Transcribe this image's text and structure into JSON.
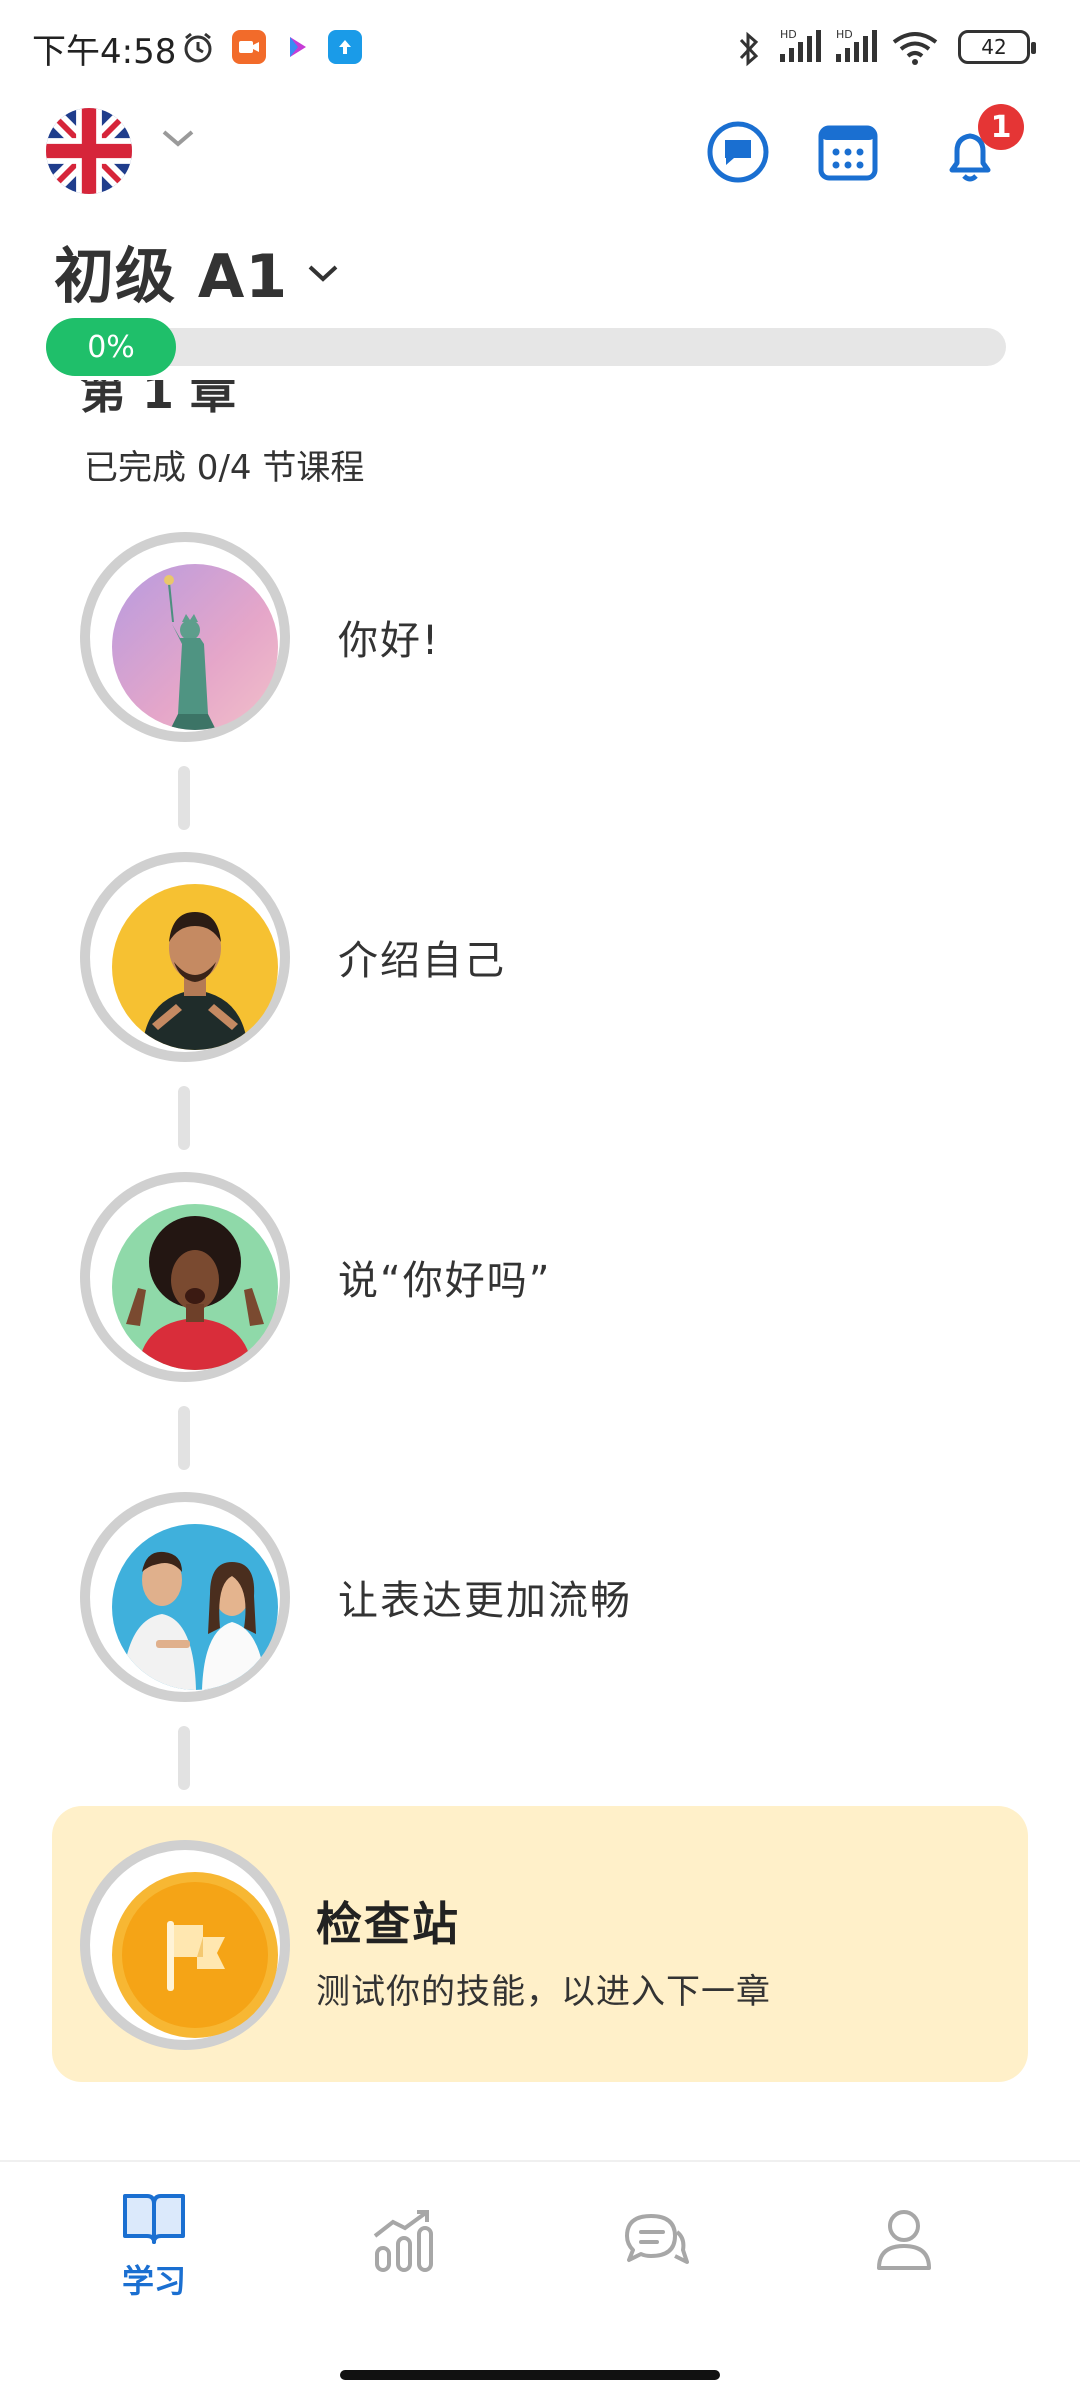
{
  "status_bar": {
    "time": "下午4:58",
    "battery": "42",
    "network_label_1": "HD",
    "network_label_2": "HD"
  },
  "header": {
    "language_flag": "uk-flag-icon",
    "notification_count": "1",
    "level_title": "初级 A1",
    "progress_text": "0%",
    "progress_value": 0
  },
  "chapter": {
    "partial_title": "第 1 章",
    "progress_text": "已完成 0/4 节课程"
  },
  "lessons": [
    {
      "label": "你好!"
    },
    {
      "label": "介绍自己"
    },
    {
      "label": "说“你好吗”"
    },
    {
      "label": "让表达更加流畅"
    }
  ],
  "checkpoint": {
    "title": "检查站",
    "subtitle": "测试你的技能，以进入下一章"
  },
  "nav": {
    "items": [
      {
        "label": "学习",
        "icon": "book-icon",
        "active": true
      },
      {
        "label": "",
        "icon": "chart-icon",
        "active": false
      },
      {
        "label": "",
        "icon": "chat-bubbles-icon",
        "active": false
      },
      {
        "label": "",
        "icon": "profile-icon",
        "active": false
      }
    ]
  },
  "colors": {
    "accent_blue": "#1a6fd1",
    "progress_green": "#1fbf6a",
    "checkpoint_bg": "#fff0c9",
    "badge_red": "#e53535"
  }
}
